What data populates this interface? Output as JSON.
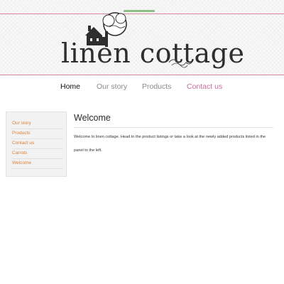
{
  "header": {
    "logo_text": "linen cottage"
  },
  "nav": {
    "items": [
      {
        "label": "Home"
      },
      {
        "label": "Our story"
      },
      {
        "label": "Products"
      },
      {
        "label": "Contact us"
      }
    ]
  },
  "sidebar": {
    "items": [
      {
        "label": "Our story"
      },
      {
        "label": "Products"
      },
      {
        "label": "Contact us"
      },
      {
        "label": "Carrots"
      },
      {
        "label": "Welcome"
      }
    ]
  },
  "content": {
    "title": "Welcome",
    "body": "Welcome to linen cottage. Head to the product listings or take a look at the newly added products listed in the panel to the left."
  },
  "colors": {
    "nav_accent": "#c86aa0",
    "sidebar_link": "#d9803a",
    "header_rule": "#d98a9a",
    "tab_accent": "#8cc084"
  }
}
